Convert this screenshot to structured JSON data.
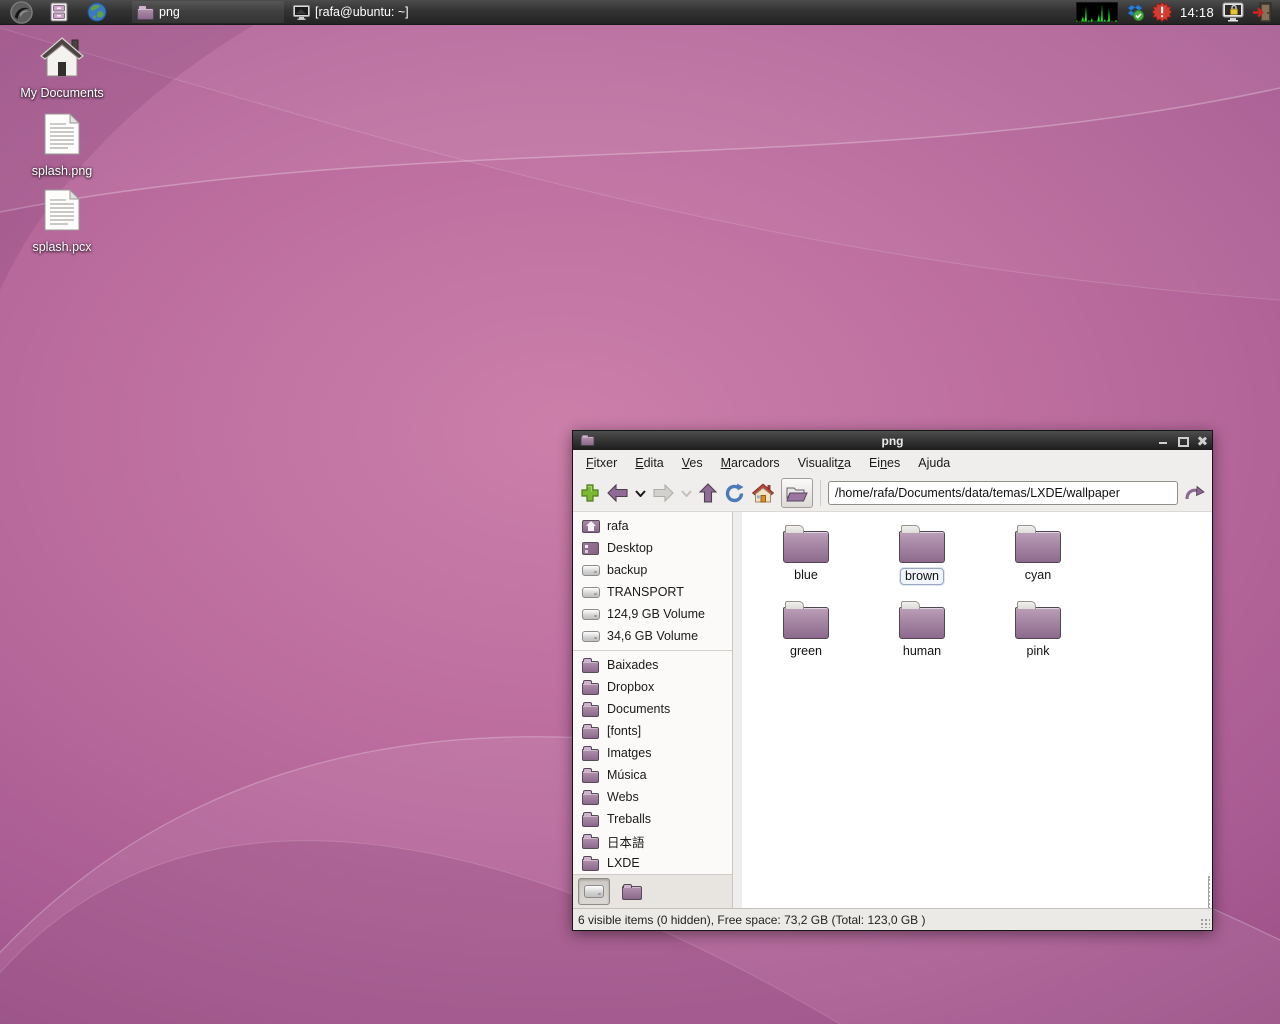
{
  "panel": {
    "launchers": [
      {
        "name": "lubuntu-menu"
      },
      {
        "name": "file-manager"
      },
      {
        "name": "web-browser"
      }
    ],
    "tasks": [
      {
        "label": "png",
        "icon": "folder",
        "active": true
      },
      {
        "label": "[rafa@ubuntu: ~]",
        "icon": "terminal-monitor",
        "active": false
      }
    ],
    "tray": {
      "clock": "14:18"
    }
  },
  "desktop": {
    "icons": [
      {
        "label": "My Documents",
        "icon": "home"
      },
      {
        "label": "splash.png",
        "icon": "document"
      },
      {
        "label": "splash.pcx",
        "icon": "document"
      }
    ]
  },
  "window": {
    "title": "png",
    "menu": [
      {
        "label": "Fitxer",
        "u": 0
      },
      {
        "label": "Edita",
        "u": 0
      },
      {
        "label": "Ves",
        "u": 0
      },
      {
        "label": "Marcadors",
        "u": 0
      },
      {
        "label": "Visualitza",
        "u": 8
      },
      {
        "label": "Eines",
        "u": 2
      },
      {
        "label": "Ajuda",
        "u": -1
      }
    ],
    "toolbar": {
      "path_value": "/home/rafa/Documents/data/temas/LXDE/wallpaper"
    },
    "sidebar": {
      "places": [
        {
          "label": "rafa",
          "icon": "home-folder"
        },
        {
          "label": "Desktop",
          "icon": "desktop"
        },
        {
          "label": "backup",
          "icon": "drive"
        },
        {
          "label": "TRANSPORT",
          "icon": "drive"
        },
        {
          "label": "124,9 GB Volume",
          "icon": "drive"
        },
        {
          "label": "34,6 GB Volume",
          "icon": "drive"
        }
      ],
      "bookmarks": [
        {
          "label": "Baixades"
        },
        {
          "label": "Dropbox"
        },
        {
          "label": "Documents"
        },
        {
          "label": "[fonts]"
        },
        {
          "label": "Imatges"
        },
        {
          "label": "Música"
        },
        {
          "label": "Webs"
        },
        {
          "label": "Treballs"
        },
        {
          "label": "日本語"
        },
        {
          "label": "LXDE"
        }
      ]
    },
    "files": [
      {
        "label": "blue",
        "selected": false
      },
      {
        "label": "brown",
        "selected": true
      },
      {
        "label": "cyan",
        "selected": false
      },
      {
        "label": "green",
        "selected": false
      },
      {
        "label": "human",
        "selected": false
      },
      {
        "label": "pink",
        "selected": false
      }
    ],
    "statusbar": {
      "text": "6 visible items (0 hidden), Free space: 73,2 GB (Total: 123,0 GB )"
    }
  }
}
